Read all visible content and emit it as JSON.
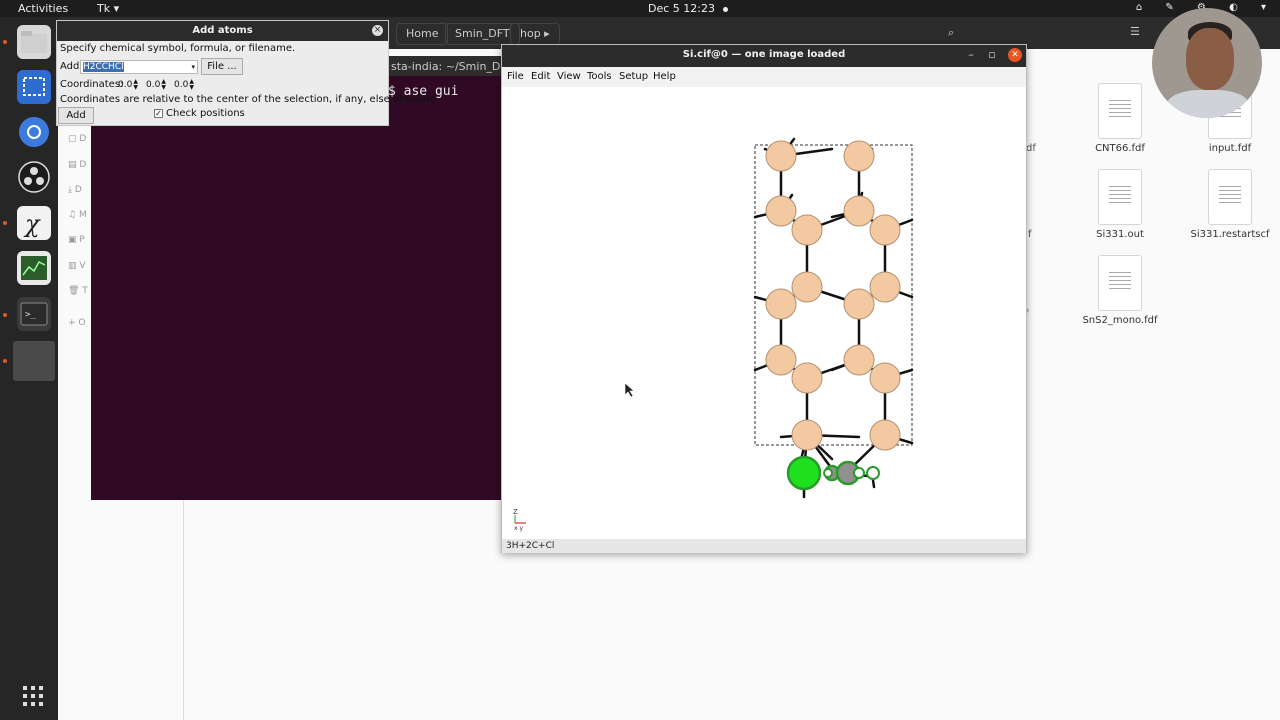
{
  "topbar": {
    "activities": "Activities",
    "app_menu": "Tk ▾",
    "clock": "Dec 5  12:23",
    "tray": "⌂ ✎ ⚙ ◐ ▾"
  },
  "files": {
    "tabs": [
      "Home",
      "Smin_DFT",
      "hop"
    ],
    "items": [
      {
        "name": "CNT66.fdf"
      },
      {
        "name": "input.fdf"
      },
      {
        "name": "Si331.out"
      },
      {
        "name": "Si331.restartscf"
      },
      {
        "name": "SnS2_mono.fdf"
      }
    ],
    "truncated": [
      "df",
      "f",
      "f"
    ],
    "sidebar_letters": [
      "D",
      "D",
      "D",
      "M",
      "P",
      "V",
      "T",
      "O"
    ]
  },
  "terminal": {
    "title": "sta-india: ~/Smin_DFT/l",
    "command": "$ ase gui"
  },
  "add_atoms": {
    "title": "Add atoms",
    "instruction": "Specify chemical symbol, formula, or filename.",
    "add_label": "Add:",
    "add_value": "H2CCHCl",
    "file_button": "File ...",
    "coordinates_label": "Coordinates:",
    "coord_x": "0.0",
    "coord_y": "0.0",
    "coord_z": "0.0",
    "note": "Coordinates are relative to the center of the selection, if any, else absolute.",
    "add_button": "Add",
    "check_positions_label": "Check positions",
    "check_positions": true
  },
  "ase_window": {
    "title": "Si.cif@0 — one image loaded",
    "menu": [
      "File",
      "Edit",
      "View",
      "Tools",
      "Setup",
      "Help"
    ],
    "status": "3H+2C+Cl",
    "axes_label_z": "Z",
    "axes_label_xy": "x y",
    "colors": {
      "silicon": "#f2c9a0",
      "chlorine": "#1fe01f",
      "carbon": "#909090",
      "hydrogen": "#ffffff",
      "selection": "#2a9a2a"
    }
  }
}
